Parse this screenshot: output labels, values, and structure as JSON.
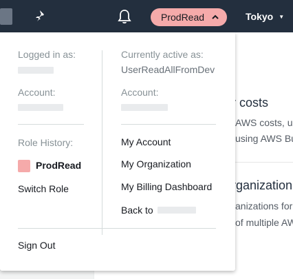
{
  "navbar": {
    "active_role_label": "ProdRead",
    "region_label": "Tokyo",
    "colors": {
      "background": "#232f3e",
      "role_pill": "#f5aaaa"
    },
    "icons": [
      "aws-logo-icon",
      "pin-icon",
      "bell-icon",
      "chevron-up-icon",
      "caret-down-icon"
    ]
  },
  "background_page": {
    "costs_heading": "ur costs",
    "costs_line1": "AWS costs, u",
    "costs_line2": "using AWS Bu",
    "org_heading": "organization",
    "org_line1": "anizations for",
    "org_line2": "of multiple AW"
  },
  "dropdown": {
    "logged_in_label": "Logged in as:",
    "left_account_label": "Account:",
    "role_history_label": "Role History:",
    "role_history_items": [
      {
        "label": "ProdRead",
        "color": "#f5aaaa"
      }
    ],
    "switch_role_label": "Switch Role",
    "currently_active_label": "Currently active as:",
    "currently_active_value": "UserReadAllFromDev",
    "right_account_label": "Account:",
    "links": {
      "my_account": "My Account",
      "my_organization": "My Organization",
      "my_billing_dashboard": "My Billing Dashboard",
      "back_to": "Back to"
    },
    "sign_out_label": "Sign Out"
  }
}
